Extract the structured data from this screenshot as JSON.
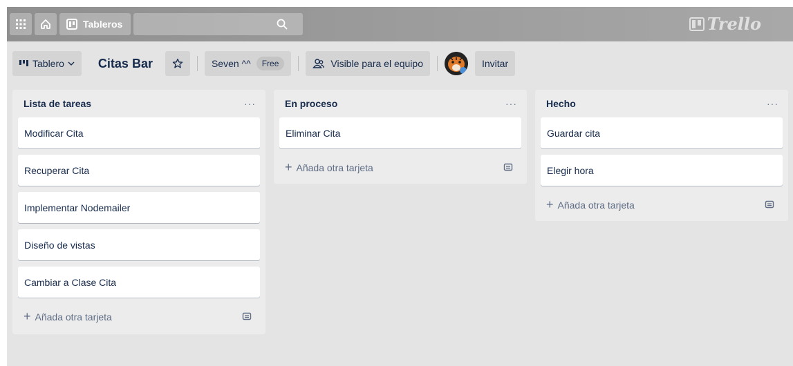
{
  "topbar": {
    "boards_label": "Tableros",
    "logo_text": "Trello",
    "icons": [
      "apps-grid-icon",
      "home-icon",
      "boards-icon",
      "search-icon",
      "trello-logo-icon"
    ]
  },
  "board_header": {
    "board_menu_label": "Tablero",
    "board_title": "Citas Bar",
    "team_label": "Seven ^^",
    "team_plan": "Free",
    "visibility_label": "Visible para el equipo",
    "invite_label": "Invitar"
  },
  "lists": [
    {
      "title": "Lista de tareas",
      "cards": [
        "Modificar Cita",
        "Recuperar Cita",
        "Implementar Nodemailer",
        "Diseño de vistas",
        "Cambiar a Clase Cita"
      ],
      "add_label": "Añada otra tarjeta"
    },
    {
      "title": "En proceso",
      "cards": [
        "Eliminar Cita"
      ],
      "add_label": "Añada otra tarjeta"
    },
    {
      "title": "Hecho",
      "cards": [
        "Guardar cita",
        "Elegir hora"
      ],
      "add_label": "Añada otra tarjeta"
    }
  ],
  "list_menu_glyph": "···",
  "colors": {
    "header_bg": "#9a9a9a",
    "board_bg": "#e4e4e4",
    "list_bg": "#ececec",
    "card_bg": "#ffffff",
    "text": "#172b4d"
  }
}
